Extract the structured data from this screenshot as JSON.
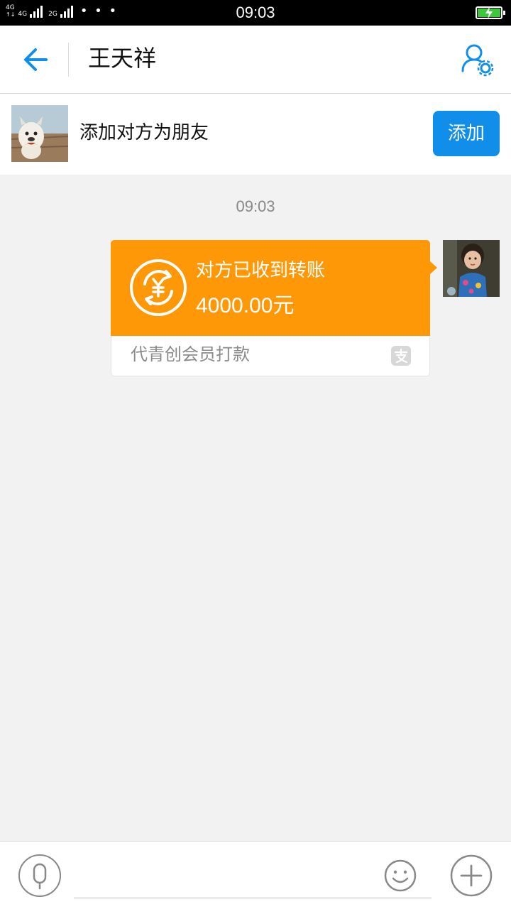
{
  "status_bar": {
    "network_1": "4G",
    "network_2": "4G",
    "network_3": "2G",
    "more": "• • •",
    "time": "09:03"
  },
  "header": {
    "title": "王天祥"
  },
  "add_friend": {
    "prompt": "添加对方为朋友",
    "button_label": "添加"
  },
  "chat": {
    "timestamp": "09:03",
    "transfer": {
      "status": "对方已收到转账",
      "amount": "4000.00元",
      "note": "代青创会员打款"
    }
  },
  "input_bar": {
    "message_value": ""
  },
  "colors": {
    "accent": "#108ee9",
    "transfer_orange": "#fe9807",
    "background": "#f2f2f2"
  },
  "icons": [
    "back-arrow-icon",
    "profile-settings-icon",
    "transfer-yuan-icon",
    "alipay-icon",
    "microphone-icon",
    "emoji-icon",
    "plus-icon"
  ]
}
